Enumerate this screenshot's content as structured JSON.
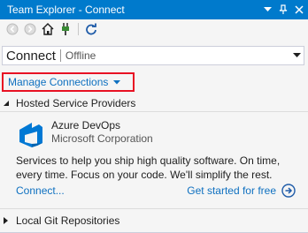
{
  "window": {
    "title": "Team Explorer - Connect",
    "buttons": [
      "dropdown-icon",
      "pin-icon",
      "close-icon"
    ]
  },
  "toolbar": {
    "items": [
      "back-icon",
      "forward-icon",
      "home-icon",
      "connect-plug-icon",
      "refresh-icon"
    ]
  },
  "header": {
    "page_title": "Connect",
    "status": "Offline"
  },
  "manage_connections": {
    "label": "Manage Connections",
    "highlight_color": "#e81123"
  },
  "hosted_section": {
    "label": "Hosted Service Providers",
    "expanded": true,
    "provider": {
      "name": "Azure DevOps",
      "company": "Microsoft Corporation",
      "description": "Services to help you ship high quality software. On time, every time. Focus on your code. We'll simplify the rest.",
      "connect_link": "Connect...",
      "get_started_link": "Get started for free"
    }
  },
  "local_git_section": {
    "label": "Local Git Repositories",
    "expanded": false
  },
  "colors": {
    "title_bar": "#007acc",
    "link": "#0e70c0",
    "azure_blue": "#0078d4"
  }
}
